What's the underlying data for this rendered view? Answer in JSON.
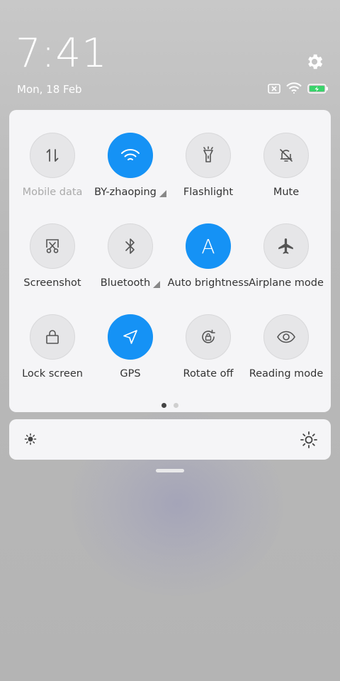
{
  "time": "7:41",
  "date": "Mon, 18 Feb",
  "colors": {
    "accent": "#1592f5",
    "tile_inactive": "#e6e6e8",
    "panel": "#f5f5f7"
  },
  "quick_settings": {
    "tiles": [
      {
        "label": "Mobile data",
        "icon": "mobile-data-icon",
        "active": false,
        "dim": true
      },
      {
        "label": "BY-zhaoping",
        "icon": "wifi-icon",
        "active": true,
        "expandable": true
      },
      {
        "label": "Flashlight",
        "icon": "flashlight-icon",
        "active": false
      },
      {
        "label": "Mute",
        "icon": "bell-off-icon",
        "active": false
      },
      {
        "label": "Screenshot",
        "icon": "screenshot-icon",
        "active": false
      },
      {
        "label": "Bluetooth",
        "icon": "bluetooth-icon",
        "active": false,
        "expandable": true
      },
      {
        "label": "Auto brightness",
        "icon": "auto-brightness-icon",
        "active": true,
        "glyph": "A"
      },
      {
        "label": "Airplane mode",
        "icon": "airplane-icon",
        "active": false
      },
      {
        "label": "Lock screen",
        "icon": "lock-icon",
        "active": false
      },
      {
        "label": "GPS",
        "icon": "location-arrow-icon",
        "active": true
      },
      {
        "label": "Rotate off",
        "icon": "rotate-lock-icon",
        "active": false
      },
      {
        "label": "Reading mode",
        "icon": "eye-icon",
        "active": false
      }
    ],
    "pages": {
      "current": 1,
      "total": 2
    }
  },
  "brightness": {
    "low_icon": "sun-small-icon",
    "high_icon": "sun-large-icon"
  }
}
